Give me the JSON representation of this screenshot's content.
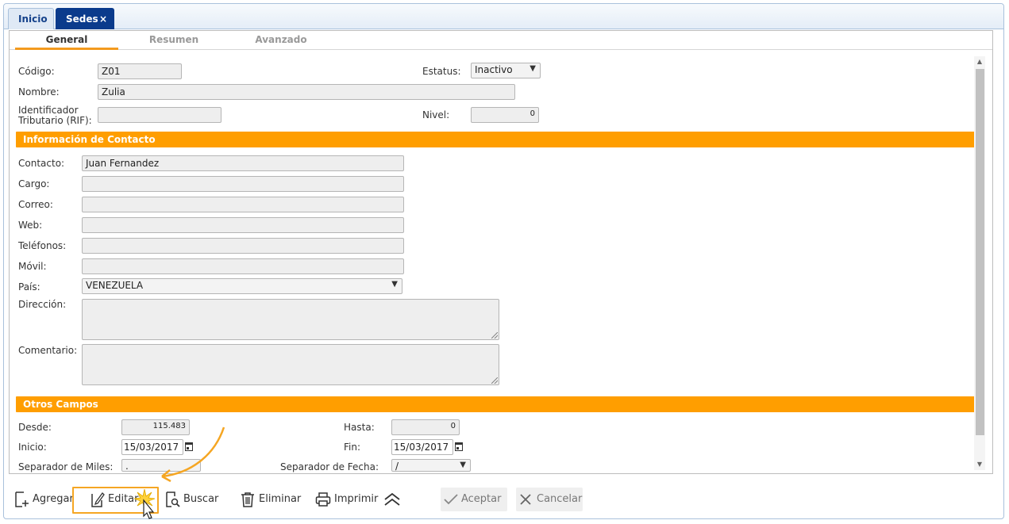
{
  "tabs": {
    "inicio": "Inicio",
    "sedes": "Sedes",
    "close": "×"
  },
  "subtabs": {
    "general": "General",
    "resumen": "Resumen",
    "avanzado": "Avanzado"
  },
  "form": {
    "codigo_label": "Código:",
    "codigo_value": "Z01",
    "estatus_label": "Estatus:",
    "estatus_value": "Inactivo",
    "nombre_label": "Nombre:",
    "nombre_value": "Zulia",
    "rif_label_1": "Identificador",
    "rif_label_2": "Tributario (RIF):",
    "rif_value": "",
    "nivel_label": "Nivel:",
    "nivel_value": "0"
  },
  "contacto": {
    "section_title": "Información de Contacto",
    "contacto_label": "Contacto:",
    "contacto_value": "Juan  Fernandez",
    "cargo_label": "Cargo:",
    "correo_label": "Correo:",
    "web_label": "Web:",
    "telefonos_label": "Teléfonos:",
    "movil_label": "Móvil:",
    "pais_label": "País:",
    "pais_value": "VENEZUELA",
    "direccion_label": "Dirección:",
    "comentario_label": "Comentario:"
  },
  "otros": {
    "section_title": "Otros Campos",
    "desde_label": "Desde:",
    "desde_value": "115.483",
    "hasta_label": "Hasta:",
    "hasta_value": "0",
    "inicio_label": "Inicio:",
    "inicio_value": "15/03/2017",
    "fin_label": "Fin:",
    "fin_value": "15/03/2017",
    "sep_miles_label": "Separador de Miles:",
    "sep_miles_value": ".",
    "sep_fecha_label": "Separador de Fecha:",
    "sep_fecha_value": "/"
  },
  "toolbar": {
    "agregar": "Agregar",
    "editar": "Editar",
    "buscar": "Buscar",
    "eliminar": "Eliminar",
    "imprimir": "Imprimir",
    "aceptar": "Aceptar",
    "cancelar": "Cancelar"
  },
  "colors": {
    "accent": "#ff9e00",
    "tab_active": "#0b3b8c",
    "highlight": "#f5a623"
  }
}
